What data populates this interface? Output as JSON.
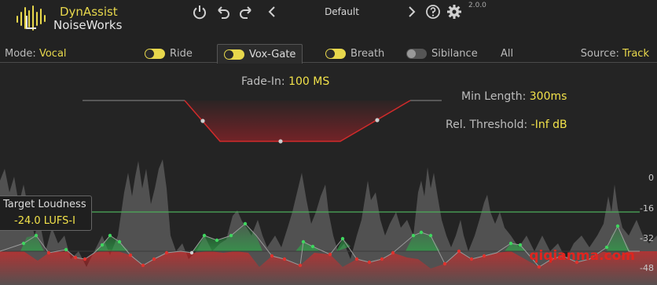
{
  "header": {
    "brand_line1": "DynAssist",
    "brand_line2": "NoiseWorks",
    "preset_name": "Default",
    "version": "2.0.0",
    "icons": [
      "power-icon",
      "undo-icon",
      "redo-icon",
      "prev-preset-icon",
      "next-preset-icon",
      "help-icon",
      "settings-icon"
    ]
  },
  "tabs_row": {
    "mode_label": "Mode:",
    "mode_value": "Vocal",
    "source_label": "Source:",
    "source_value": "Track",
    "tabs": [
      {
        "label": "Ride",
        "enabled": true,
        "active": false
      },
      {
        "label": "Vox-Gate",
        "enabled": true,
        "active": true
      },
      {
        "label": "Breath",
        "enabled": true,
        "active": false
      },
      {
        "label": "Sibilance",
        "enabled": false,
        "active": false
      },
      {
        "label": "All",
        "enabled": null,
        "active": false
      }
    ]
  },
  "gate": {
    "fade_in_label": "Fade-In:",
    "fade_in_value": "100 MS",
    "min_length_label": "Min Length:",
    "min_length_value": "300ms",
    "rel_threshold_label": "Rel. Threshold:",
    "rel_threshold_value": "-Inf dB"
  },
  "loudness": {
    "label": "Target Loudness",
    "value": "-24.0 LUFS-I"
  },
  "scale_labels": [
    "0",
    "-16",
    "-32",
    "-48"
  ],
  "colors": {
    "accent": "#e8d84c",
    "gain_up": "#3fd65f",
    "gain_down": "#e0332e",
    "waveform": "#5a5a5a",
    "target_line": "#4cae5a"
  },
  "watermark": "qiqianma.com"
}
